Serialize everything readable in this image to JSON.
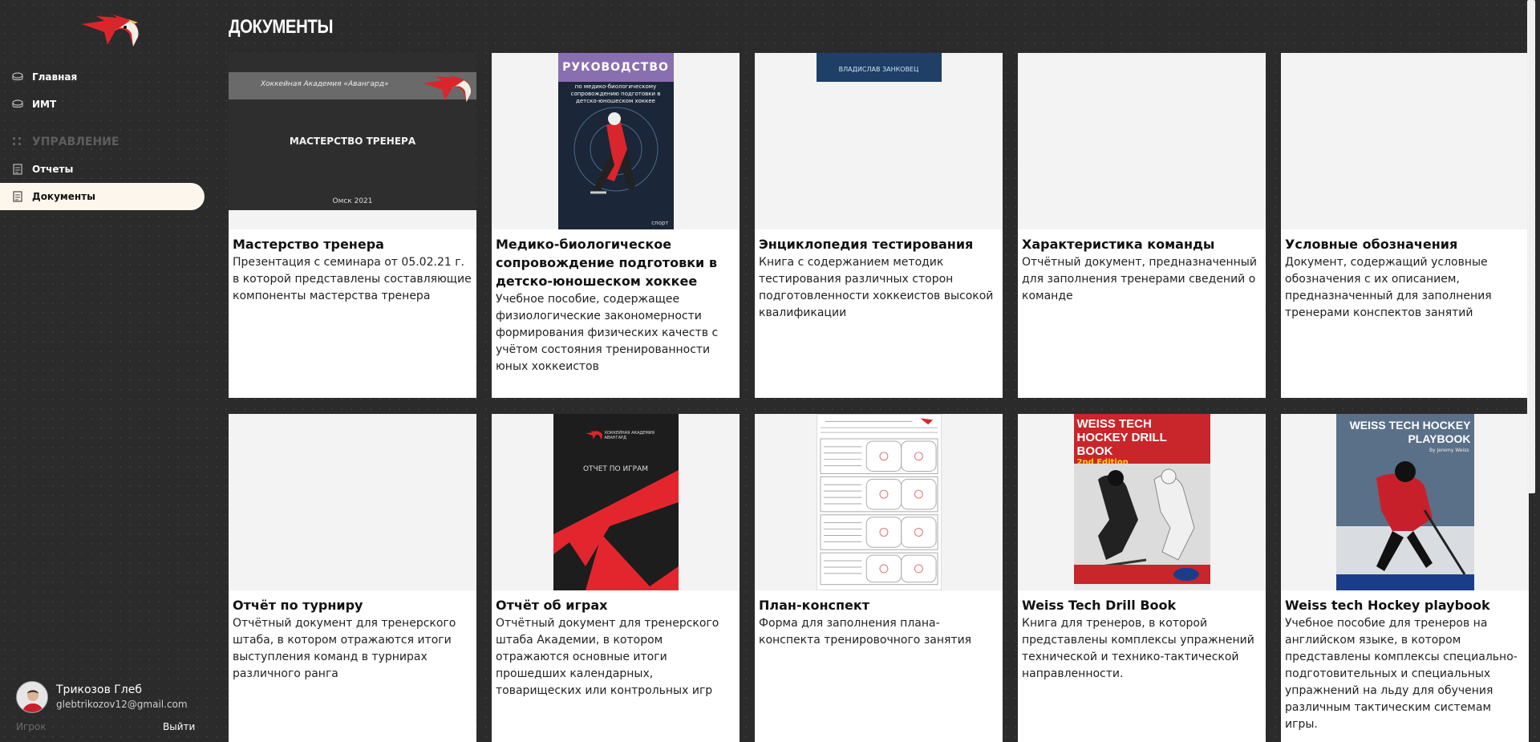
{
  "sidebar": {
    "logo_icon": "hawk-logo-icon",
    "items": [
      {
        "label": "Главная",
        "icon": "puck-icon"
      },
      {
        "label": "ИМТ",
        "icon": "puck-icon"
      }
    ],
    "section_label": "УПРАВЛЕНИЕ",
    "section_icon": "grid-dots-icon",
    "manage_items": [
      {
        "label": "Отчеты",
        "icon": "document-icon"
      },
      {
        "label": "Документы",
        "icon": "document-icon",
        "active": true
      }
    ]
  },
  "user": {
    "name": "Трикозов Глеб",
    "email": "glebtrikozov12@gmail.com",
    "role": "Игрок",
    "logout_label": "Выйти"
  },
  "page": {
    "title": "ДОКУМЕНТЫ"
  },
  "cards": [
    {
      "title": "Мастерство тренера",
      "description": "Презентация с семинара от 05.02.21 г. в которой представлены составляющие компоненты мастерства тренера",
      "thumb": {
        "header": "Хоккейная Академия «Авангард»",
        "title": "МАСТЕРСТВО ТРЕНЕРА",
        "footer": "Омск 2021"
      }
    },
    {
      "title": "Медико-биологическое сопровождение подготовки в детско-юношеском хоккее",
      "description": "Учебное пособие, содержащее физиологические закономерности формирования физических качеств с учётом состояния тренированности юных хоккеистов",
      "thumb": {
        "header": "РУКОВОДСТВО",
        "subtitle": "по медико-биологическому сопровождению подготовки в детско-юношеском хоккее",
        "footer": "спорт"
      }
    },
    {
      "title": "Энциклопедия тестирования",
      "description": "Книга с содержанием методик тестирования различных сторон подготовленности хоккеистов высокой квалификации",
      "thumb": {
        "header": "ВЛАДИСЛАВ ЗАНКОВЕЦ"
      }
    },
    {
      "title": "Характеристика команды",
      "description": "Отчётный документ, предназначенный для заполнения тренерами сведений о команде"
    },
    {
      "title": "Условные обозначения",
      "description": "Документ, содержащий условные обозначения с их описанием, предназначенный для заполнения тренерами конспектов занятий"
    },
    {
      "title": "Отчёт по турниру",
      "description": "Отчётный документ для тренерского штаба, в котором отражаются итоги выступления команд в турнирах различного ранга"
    },
    {
      "title": "Отчёт об играх",
      "description": "Отчётный документ для тренерского штаба Академии, в котором отражаются основные итоги прошедших календарных, товарищеских или контрольных игр",
      "thumb": {
        "header": "ХОККЕЙНАЯ АКАДЕМИЯ АВАНГАРД",
        "title": "ОТЧЕТ ПО ИГРАМ"
      }
    },
    {
      "title": "План-конспект",
      "description": "Форма для заполнения плана-конспекта тренировочного занятия"
    },
    {
      "title": "Weiss Tech Drill Book",
      "description": "Книга для тренеров, в которой представлены комплексы упражнений технической и технико-тактической направленности.",
      "thumb": {
        "header": "WEISS TECH HOCKEY DRILL BOOK",
        "subtitle": "2nd Edition"
      }
    },
    {
      "title": "Weiss tech Hockey playbook",
      "description": "Учебное пособие для тренеров на английском языке, в котором представлены комплексы специально-подготовительных и специальных упражнений на льду для обучения различным тактическим системам игры.",
      "thumb": {
        "header": "WEISS TECH HOCKEY PLAYBOOK",
        "subtitle": "By Jeremy Weiss"
      }
    }
  ],
  "colors": {
    "background": "#2b2b2b",
    "active_nav": "#fdf6ec",
    "brand_red": "#d8262c"
  }
}
